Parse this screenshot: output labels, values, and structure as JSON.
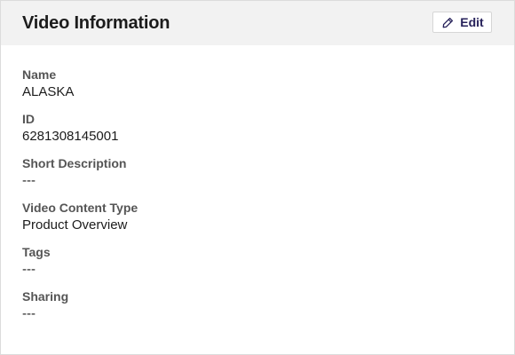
{
  "header": {
    "title": "Video Information",
    "edit_label": "Edit",
    "edit_icon": "pencil-icon"
  },
  "fields": [
    {
      "label": "Name",
      "value": "ALASKA"
    },
    {
      "label": "ID",
      "value": "6281308145001"
    },
    {
      "label": "Short Description",
      "value": "---"
    },
    {
      "label": "Video Content Type",
      "value": "Product Overview"
    },
    {
      "label": "Tags",
      "value": "---"
    },
    {
      "label": "Sharing",
      "value": "---"
    }
  ],
  "colors": {
    "header_background": "#f2f2f2",
    "accent": "#26215a",
    "label": "#555555",
    "text": "#1c1c1c"
  }
}
